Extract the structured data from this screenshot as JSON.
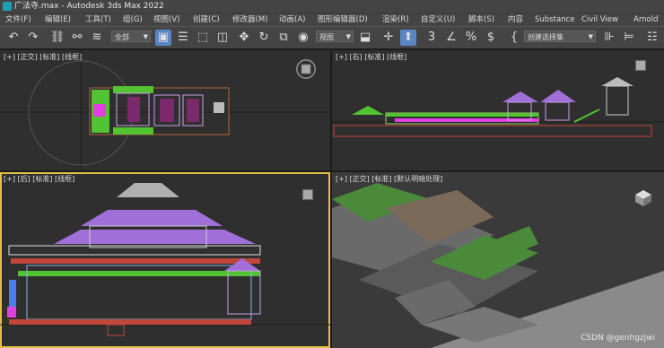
{
  "title": {
    "text": "广法寺.max - Autodesk 3ds Max 2022"
  },
  "menu": [
    "文件(F)",
    "编辑(E)",
    "工具(T)",
    "组(G)",
    "视图(V)",
    "创建(C)",
    "修改器(M)",
    "动画(A)",
    "图形编辑器(D)",
    "渲染(R)",
    "自定义(U)",
    "脚本(S)",
    "内容",
    "Substance",
    "Civil View",
    "Arnold"
  ],
  "toolbar": {
    "selection_filter": "全部",
    "reference_coord": "视图",
    "named_selection_set": "创建选择集"
  },
  "viewports": {
    "top": {
      "label": "[+] [正交] [标准] [线框]"
    },
    "right": {
      "label": "[+] [右] [标准] [线框]"
    },
    "back": {
      "label": "[+] [后] [标准] [线框]"
    },
    "perspective": {
      "label": "[+] [正交] [标准] [默认明暗处理]"
    }
  },
  "watermark": "CSDN @genhgzjwi"
}
